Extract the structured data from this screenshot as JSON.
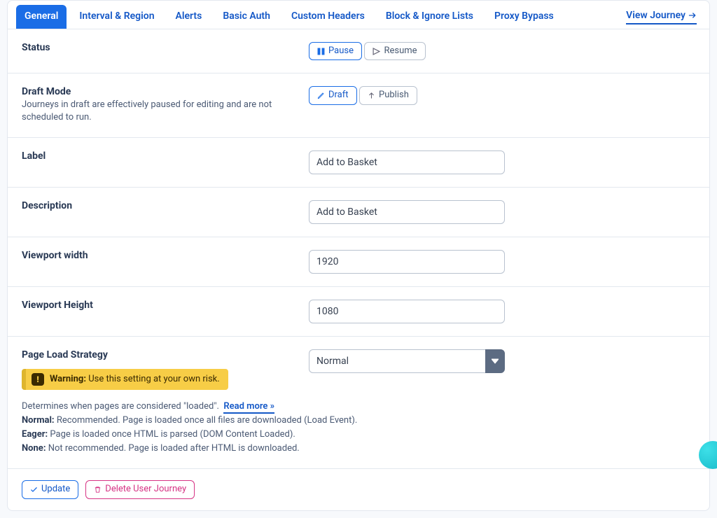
{
  "tabs": {
    "items": [
      "General",
      "Interval & Region",
      "Alerts",
      "Basic Auth",
      "Custom Headers",
      "Block & Ignore Lists",
      "Proxy Bypass"
    ],
    "active_index": 0,
    "view_journey": "View Journey"
  },
  "status": {
    "label": "Status",
    "pause": "Pause",
    "resume": "Resume"
  },
  "draft": {
    "label": "Draft Mode",
    "help": "Journeys in draft are effectively paused for editing and are not scheduled to run.",
    "draft_btn": "Draft",
    "publish_btn": "Publish"
  },
  "label_field": {
    "label": "Label",
    "value": "Add to Basket"
  },
  "description_field": {
    "label": "Description",
    "value": "Add to Basket"
  },
  "viewport_width": {
    "label": "Viewport width",
    "value": "1920"
  },
  "viewport_height": {
    "label": "Viewport Height",
    "value": "1080"
  },
  "page_load": {
    "label": "Page Load Strategy",
    "value": "Normal",
    "warning_title": "Warning:",
    "warning_text": "Use this setting at your own risk.",
    "intro": "Determines when pages are considered \"loaded\".",
    "read_more": "Read more »",
    "normal_b": "Normal:",
    "normal_t": "Recommended. Page is loaded once all files are downloaded (Load Event).",
    "eager_b": "Eager:",
    "eager_t": "Page is loaded once HTML is parsed (DOM Content Loaded).",
    "none_b": "None:",
    "none_t": "Not recommended. Page is loaded after HTML is downloaded."
  },
  "actions": {
    "update": "Update",
    "delete": "Delete User Journey"
  }
}
